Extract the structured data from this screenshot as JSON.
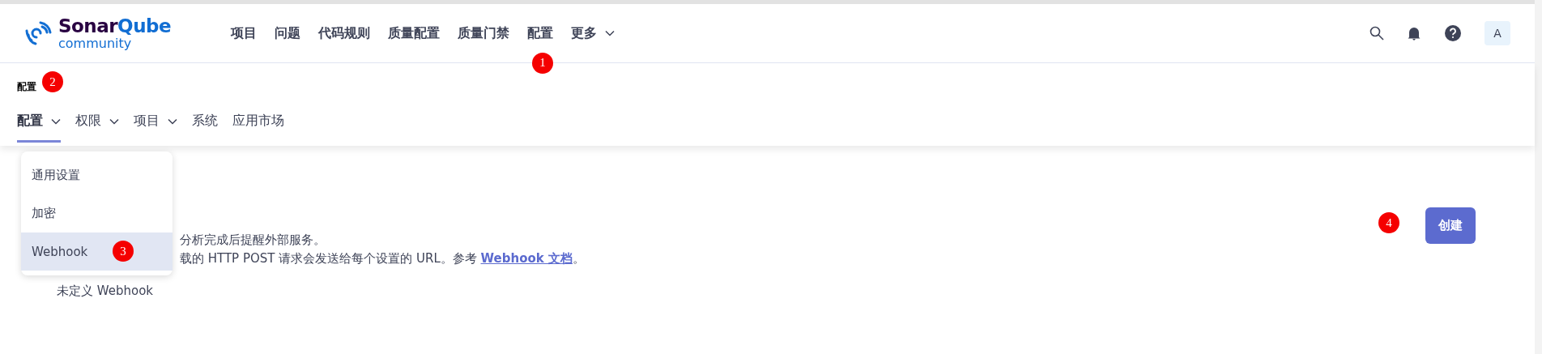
{
  "header": {
    "logo": {
      "name_dark": "Sonar",
      "name_blue": "Qube",
      "edition": "community"
    },
    "nav": [
      {
        "label": "项目",
        "dropdown": false
      },
      {
        "label": "问题",
        "dropdown": false
      },
      {
        "label": "代码规则",
        "dropdown": false
      },
      {
        "label": "质量配置",
        "dropdown": false
      },
      {
        "label": "质量门禁",
        "dropdown": false
      },
      {
        "label": "配置",
        "dropdown": false
      },
      {
        "label": "更多",
        "dropdown": true
      }
    ],
    "avatar": "A"
  },
  "page_title": "配置",
  "tabs": [
    {
      "label": "配置",
      "selected": true,
      "dropdown": true
    },
    {
      "label": "权限",
      "selected": false,
      "dropdown": true
    },
    {
      "label": "项目",
      "selected": false,
      "dropdown": true
    },
    {
      "label": "系统",
      "selected": false,
      "dropdown": false
    },
    {
      "label": "应用市场",
      "selected": false,
      "dropdown": false
    }
  ],
  "menu": [
    {
      "label": "通用设置",
      "selected": false
    },
    {
      "label": "加密",
      "selected": false
    },
    {
      "label": "Webhook",
      "selected": true
    }
  ],
  "content": {
    "line_1": "分析完成后提醒外部服务。",
    "line_2": "载的 HTTP POST 请求会发送给每个设置的 URL。参考 ",
    "link": "Webhook 文档",
    "line_2_end": "。",
    "empty": "未定义 Webhook"
  },
  "create_button": "创建",
  "markers": [
    {
      "label": "1"
    },
    {
      "label": "2"
    },
    {
      "label": "3"
    },
    {
      "label": "4"
    }
  ]
}
